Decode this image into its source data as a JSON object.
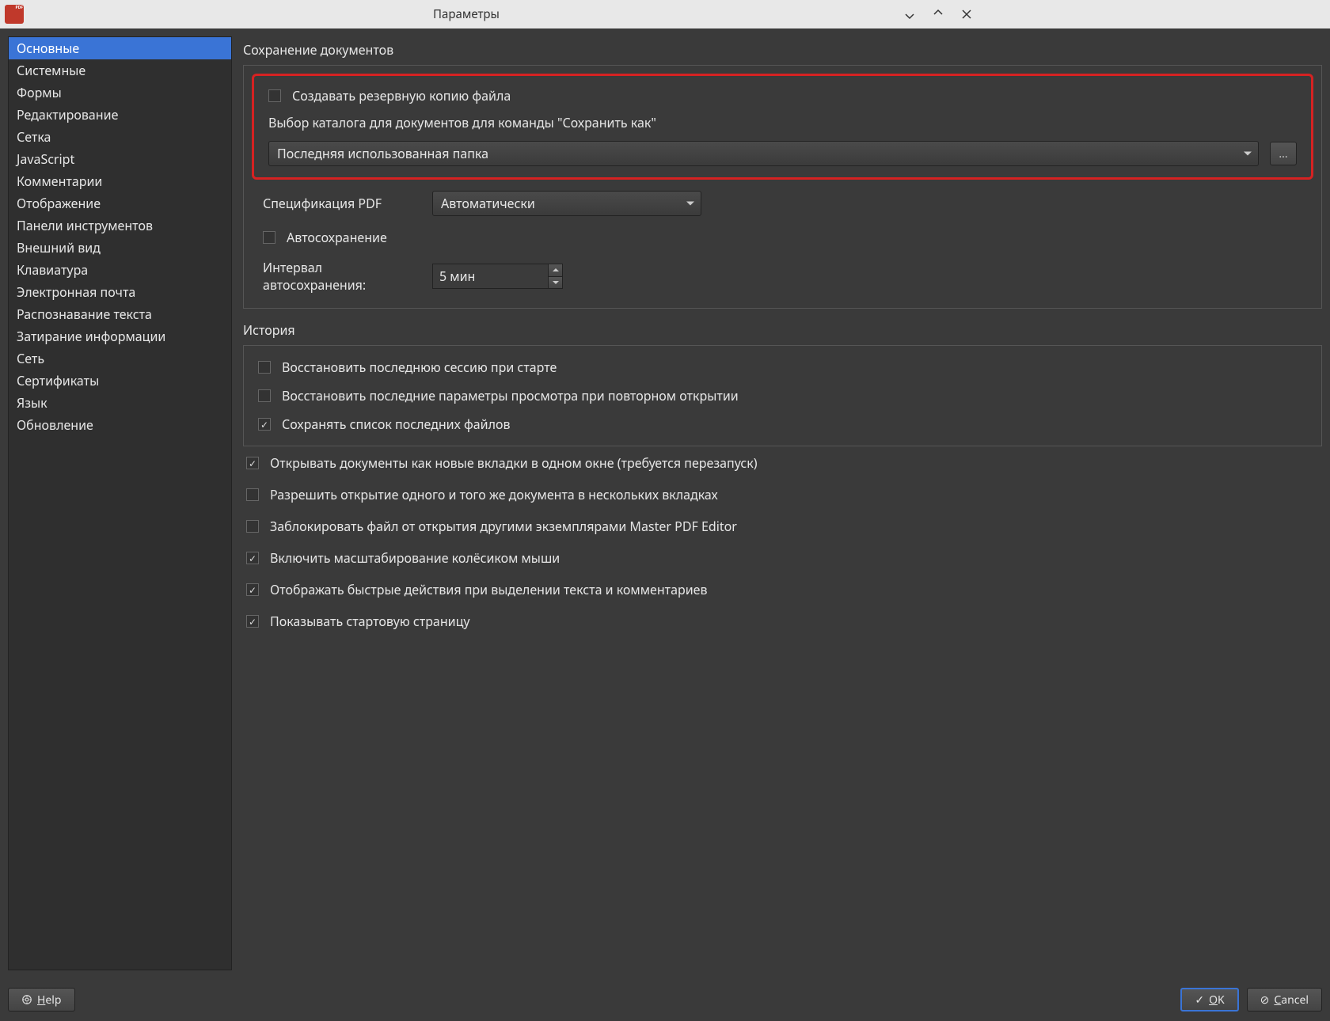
{
  "window": {
    "title": "Параметры"
  },
  "sidebar": {
    "items": [
      "Основные",
      "Системные",
      "Формы",
      "Редактирование",
      "Сетка",
      "JavaScript",
      "Комментарии",
      "Отображение",
      "Панели инструментов",
      "Внешний вид",
      "Клавиатура",
      "Электронная почта",
      "Распознавание текста",
      "Затирание информации",
      "Сеть",
      "Сертификаты",
      "Язык",
      "Обновление"
    ],
    "selected_index": 0
  },
  "saving": {
    "section_title": "Сохранение документов",
    "backup_label": "Создавать резервную копию файла",
    "save_as_dir_label": "Выбор каталога для документов для команды \"Сохранить как\"",
    "save_as_dir_value": "Последняя использованная папка",
    "browse_btn": "...",
    "pdf_spec_label": "Спецификация PDF",
    "pdf_spec_value": "Автоматически",
    "autosave_label": "Автосохранение",
    "autosave_interval_label": "Интервал автосохранения:",
    "autosave_interval_value": "5 мин"
  },
  "history": {
    "section_title": "История",
    "restore_session": "Восстановить последнюю сессию при старте",
    "restore_view": "Восстановить последние параметры просмотра при повторном открытии",
    "keep_recent": "Сохранять список последних файлов"
  },
  "misc": {
    "tabs_one_window": "Открывать документы как новые вкладки в одном окне (требуется перезапуск)",
    "allow_multi_tab": "Разрешить открытие одного и того же документа в нескольких вкладках",
    "lock_file": "Заблокировать файл от открытия другими экземплярами Master PDF Editor",
    "wheel_zoom": "Включить масштабирование колёсиком мыши",
    "quick_actions": "Отображать быстрые действия при выделении текста и комментариев",
    "start_page": "Показывать стартовую страницу"
  },
  "footer": {
    "help": "Help",
    "ok": "OK",
    "cancel": "Cancel"
  }
}
